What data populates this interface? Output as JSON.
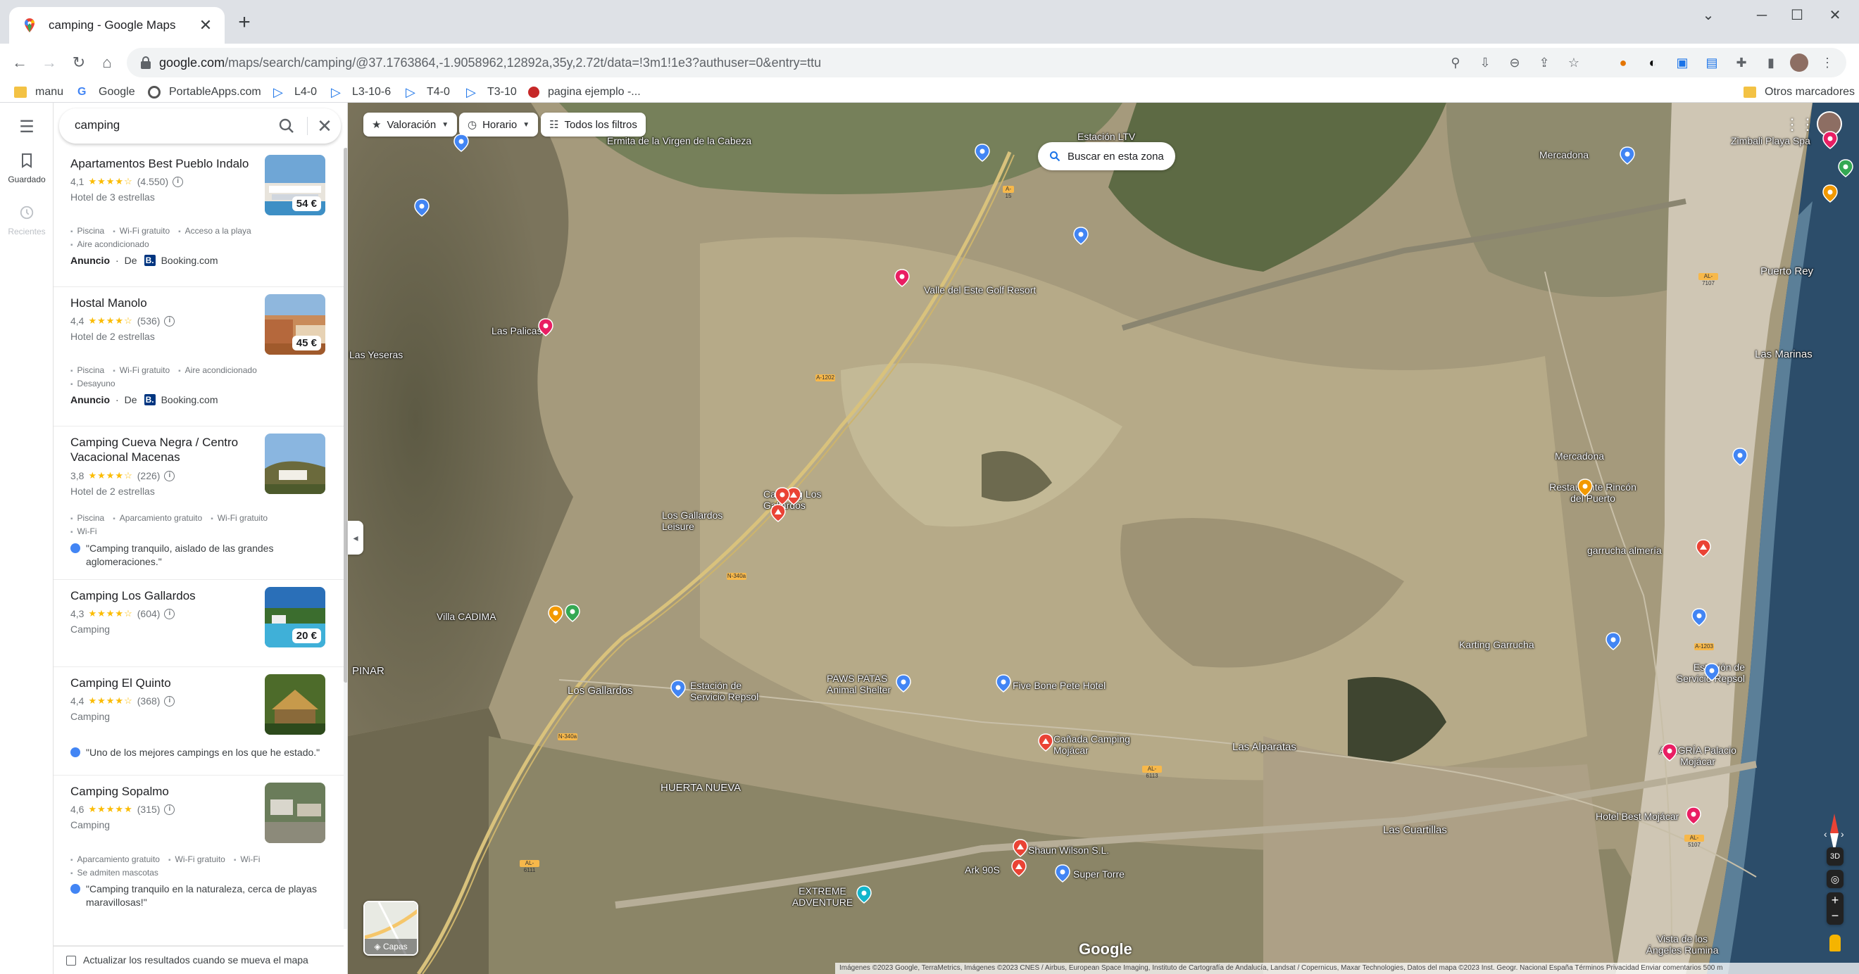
{
  "browser": {
    "tab_title": "camping - Google Maps",
    "url_host": "google.com",
    "url_path": "/maps/search/camping/@37.1763864,-1.9058962,12892a,35y,2.72t/data=!3m1!1e3?authuser=0&entry=ttu"
  },
  "bookmarks": [
    {
      "label": "manu",
      "icon": "folder-icon"
    },
    {
      "label": "Google",
      "icon": "google-icon"
    },
    {
      "label": "PortableApps.com",
      "icon": "portableapps-icon"
    },
    {
      "label": "L4-0",
      "icon": "play-icon"
    },
    {
      "label": "L3-10-6",
      "icon": "play-icon"
    },
    {
      "label": "T4-0",
      "icon": "play-icon"
    },
    {
      "label": "T3-10",
      "icon": "play-icon"
    },
    {
      "label": "pagina ejemplo -...",
      "icon": "redbird-icon"
    }
  ],
  "other_bookmarks": "Otros marcadores",
  "rail": {
    "saved": "Guardado",
    "recent": "Recientes"
  },
  "search": {
    "query": "camping"
  },
  "results": [
    {
      "name": "Apartamentos Best Pueblo Indalo",
      "rating": "4,1",
      "stars": "★★★★☆",
      "reviews": "(4.550)",
      "type": "Hotel de 3 estrellas",
      "price": "54 €",
      "amenities1": [
        "Piscina",
        "Wi-Fi gratuito",
        "Acceso a la playa"
      ],
      "amenities2": [
        "Aire acondicionado"
      ],
      "ad_label": "Anuncio",
      "ad_from": "De",
      "ad_source": "Booking.com"
    },
    {
      "name": "Hostal Manolo",
      "rating": "4,4",
      "stars": "★★★★☆",
      "reviews": "(536)",
      "type": "Hotel de 2 estrellas",
      "price": "45 €",
      "amenities1": [
        "Piscina",
        "Wi-Fi gratuito",
        "Aire acondicionado"
      ],
      "amenities2": [
        "Desayuno"
      ],
      "ad_label": "Anuncio",
      "ad_from": "De",
      "ad_source": "Booking.com"
    },
    {
      "name": "Camping Cueva Negra / Centro Vacacional Macenas",
      "rating": "3,8",
      "stars": "★★★★☆",
      "reviews": "(226)",
      "type": "Hotel de 2 estrellas",
      "amenities1": [
        "Piscina",
        "Aparcamiento gratuito",
        "Wi-Fi gratuito"
      ],
      "amenities2": [
        "Wi-Fi"
      ],
      "review": "\"Camping tranquilo, aislado de las grandes aglomeraciones.\""
    },
    {
      "name": "Camping Los Gallardos",
      "rating": "4,3",
      "stars": "★★★★☆",
      "reviews": "(604)",
      "type": "Camping",
      "price": "20 €"
    },
    {
      "name": "Camping El Quinto",
      "rating": "4,4",
      "stars": "★★★★☆",
      "reviews": "(368)",
      "type": "Camping",
      "review": "\"Uno de los mejores campings en los que he estado.\""
    },
    {
      "name": "Camping Sopalmo",
      "rating": "4,6",
      "stars": "★★★★★",
      "reviews": "(315)",
      "type": "Camping",
      "amenities1": [
        "Aparcamiento gratuito",
        "Wi-Fi gratuito",
        "Wi-Fi"
      ],
      "amenities2": [
        "Se admiten mascotas"
      ],
      "review": "\"Camping tranquilo en la naturaleza, cerca de playas maravillosas!\""
    }
  ],
  "footer_checkbox": "Actualizar los resultados cuando se mueva el mapa",
  "map": {
    "chips": [
      "Valoración",
      "Horario",
      "Todos los filtros"
    ],
    "search_area": "Buscar en esta zona",
    "layers": "Capas",
    "logo": "Google",
    "attribution": "Imágenes ©2023 Google, TerraMetrics, Imágenes ©2023 CNES / Airbus, European Space Imaging, Instituto de Cartografía de Andalucía, Landsat / Copernicus, Maxar Technologies, Datos del mapa ©2023 Inst. Geogr. Nacional   España   Términos   Privacidad   Enviar comentarios   500 m",
    "ctl_3d": "3D",
    "labels": [
      "Ermita de la Virgen de la Cabeza",
      "Estación LTV",
      "Mercadona",
      "Zimbali Playa Spa",
      "Valle del Este Golf Resort",
      "Las Palicas",
      "Las Yeseras",
      "Puerto Rey",
      "Las Marinas",
      "Mercadona",
      "Restaurante Rincón del Puerto",
      "garrucha almería",
      "Camping Los Gallardos",
      "Los Gallardos Leisure",
      "Villa CADIMA",
      "PINAR",
      "Los Gallardos",
      "Estación de Servicio Repsol",
      "PAWS PATAS Animal Shelter",
      "Five Bone Pete Hotel",
      "Karting Garrucha",
      "Estación de Servicio Repsol",
      "Cañada Camping Mojácar",
      "Las Alparatas",
      "ALEGRÍA Palacio Mojácar",
      "HUERTA NUEVA",
      "Las Cuartillas",
      "Hotel Best Mojácar",
      "Shaun Wilson S.L.",
      "Ark 90S",
      "Super Torre",
      "EXTREME ADVENTURE",
      "Vista de los Ángeles Rumina"
    ],
    "road_labels": [
      "A-15",
      "A-1202",
      "N-340a",
      "AL-6111",
      "AL-5107",
      "AL-7107",
      "A-1203",
      "AL-6113",
      "N-340a"
    ]
  }
}
